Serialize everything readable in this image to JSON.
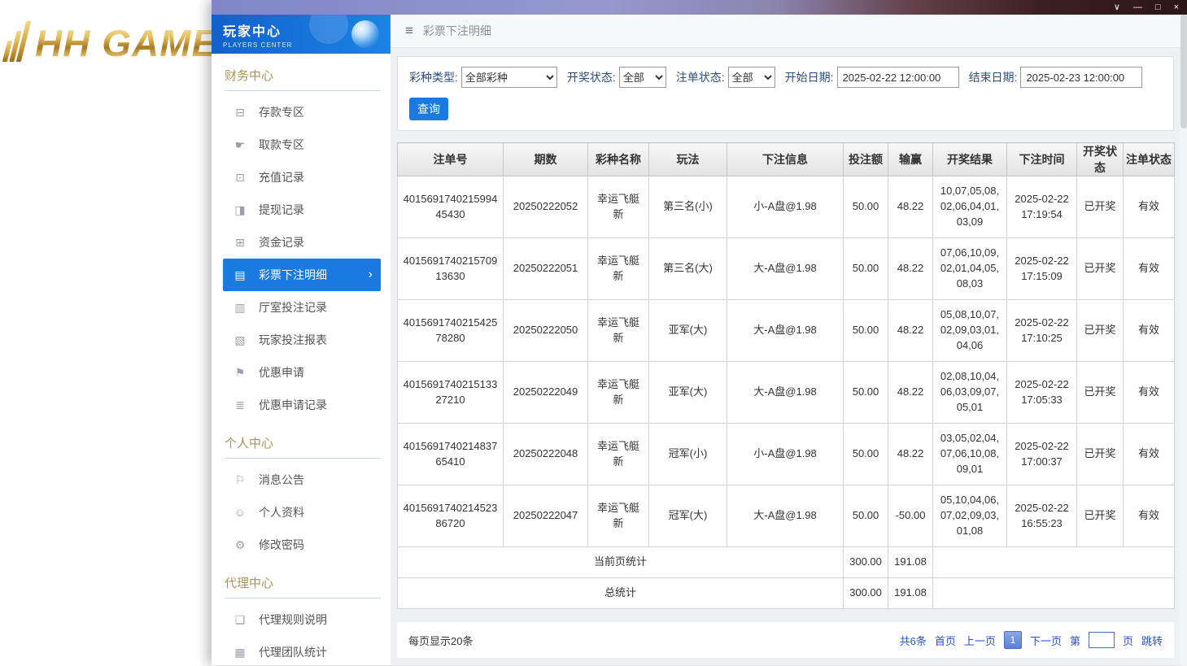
{
  "colors": {
    "accent_blue": "#1a7ae2",
    "sidebar_gold": "#ab935b",
    "link_blue": "#2b4fcc"
  },
  "logo": {
    "text": "HH GAME"
  },
  "window": {
    "controls": {
      "chevron": "∨",
      "minimize": "—",
      "maximize": "□",
      "close": "×"
    }
  },
  "sidebar": {
    "header": {
      "title": "玩家中心",
      "subtitle": "PLAYERS CENTER"
    },
    "sections": [
      {
        "title": "财务中心",
        "items": [
          {
            "label": "存款专区",
            "icon_name": "deposit-icon",
            "glyph": "⊟"
          },
          {
            "label": "取款专区",
            "icon_name": "withdraw-icon",
            "glyph": "☛"
          },
          {
            "label": "充值记录",
            "icon_name": "recharge-record-icon",
            "glyph": "⊡"
          },
          {
            "label": "提现记录",
            "icon_name": "withdraw-record-icon",
            "glyph": "◨"
          },
          {
            "label": "资金记录",
            "icon_name": "funds-record-icon",
            "glyph": "⊞"
          },
          {
            "label": "彩票下注明细",
            "icon_name": "lottery-bet-detail-icon",
            "glyph": "▤",
            "active": true,
            "arrow": "›"
          },
          {
            "label": "厅室投注记录",
            "icon_name": "hall-bet-record-icon",
            "glyph": "▥"
          },
          {
            "label": "玩家投注报表",
            "icon_name": "player-bet-report-icon",
            "glyph": "▧"
          },
          {
            "label": "优惠申请",
            "icon_name": "promo-apply-icon",
            "glyph": "⚑"
          },
          {
            "label": "优惠申请记录",
            "icon_name": "promo-apply-record-icon",
            "glyph": "≣"
          }
        ]
      },
      {
        "title": "个人中心",
        "items": [
          {
            "label": "消息公告",
            "icon_name": "announcement-bell-icon",
            "glyph": "⚐"
          },
          {
            "label": "个人资料",
            "icon_name": "profile-icon",
            "glyph": "☺"
          },
          {
            "label": "修改密码",
            "icon_name": "password-gear-icon",
            "glyph": "⚙"
          }
        ]
      },
      {
        "title": "代理中心",
        "items": [
          {
            "label": "代理规则说明",
            "icon_name": "agent-rules-icon",
            "glyph": "❏"
          },
          {
            "label": "代理团队统计",
            "icon_name": "agent-team-stats-icon",
            "glyph": "▦"
          }
        ]
      }
    ]
  },
  "header": {
    "title": "彩票下注明细"
  },
  "filters": {
    "lottery_type": {
      "label": "彩种类型:",
      "value": "全部彩种"
    },
    "draw_status": {
      "label": "开奖状态:",
      "value": "全部"
    },
    "order_status": {
      "label": "注单状态:",
      "value": "全部"
    },
    "start_date": {
      "label": "开始日期:",
      "value": "2025-02-22 12:00:00"
    },
    "end_date": {
      "label": "结束日期:",
      "value": "2025-02-23 12:00:00"
    },
    "search_button": "查询"
  },
  "table": {
    "columns": [
      "注单号",
      "期数",
      "彩种名称",
      "玩法",
      "下注信息",
      "投注额",
      "输赢",
      "开奖结果",
      "下注时间",
      "开奖状态",
      "注单状态"
    ],
    "rows": [
      [
        "401569174021599445430",
        "20250222052",
        "幸运飞艇新",
        "第三名(小)",
        "小-A盘@1.98",
        "50.00",
        "48.22",
        "10,07,05,08,02,06,04,01,03,09",
        "2025-02-22 17:19:54",
        "已开奖",
        "有效"
      ],
      [
        "401569174021570913630",
        "20250222051",
        "幸运飞艇新",
        "第三名(大)",
        "大-A盘@1.98",
        "50.00",
        "48.22",
        "07,06,10,09,02,01,04,05,08,03",
        "2025-02-22 17:15:09",
        "已开奖",
        "有效"
      ],
      [
        "401569174021542578280",
        "20250222050",
        "幸运飞艇新",
        "亚军(大)",
        "大-A盘@1.98",
        "50.00",
        "48.22",
        "05,08,10,07,02,09,03,01,04,06",
        "2025-02-22 17:10:25",
        "已开奖",
        "有效"
      ],
      [
        "401569174021513327210",
        "20250222049",
        "幸运飞艇新",
        "亚军(大)",
        "大-A盘@1.98",
        "50.00",
        "48.22",
        "02,08,10,04,06,03,09,07,05,01",
        "2025-02-22 17:05:33",
        "已开奖",
        "有效"
      ],
      [
        "401569174021483765410",
        "20250222048",
        "幸运飞艇新",
        "冠军(小)",
        "小-A盘@1.98",
        "50.00",
        "48.22",
        "03,05,02,04,07,06,10,08,09,01",
        "2025-02-22 17:00:37",
        "已开奖",
        "有效"
      ],
      [
        "401569174021452386720",
        "20250222047",
        "幸运飞艇新",
        "冠军(大)",
        "大-A盘@1.98",
        "50.00",
        "-50.00",
        "05,10,04,06,07,02,09,03,01,08",
        "2025-02-22 16:55:23",
        "已开奖",
        "有效"
      ]
    ],
    "summary": [
      {
        "label": "当前页统计",
        "bet_total": "300.00",
        "winloss_total": "191.08"
      },
      {
        "label": "总统计",
        "bet_total": "300.00",
        "winloss_total": "191.08"
      }
    ]
  },
  "footer": {
    "page_size": "每页显示20条",
    "pagination": {
      "total": "共6条",
      "first": "首页",
      "prev": "上一页",
      "current": "1",
      "next": "下一页",
      "jump_pre": "第",
      "jump_post": "页",
      "jump_btn": "跳转"
    }
  }
}
